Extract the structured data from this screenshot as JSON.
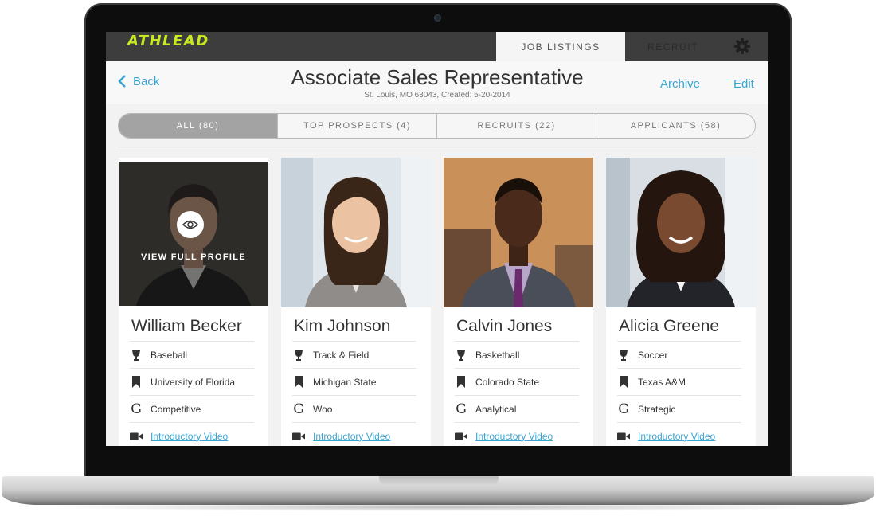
{
  "app": {
    "logo": "ATHLEAD",
    "accent": "#c7ea21",
    "link_color": "#3aa5d3"
  },
  "nav": {
    "tabs": [
      {
        "label": "JOB LISTINGS",
        "active": true
      },
      {
        "label": "RECRUIT",
        "active": false
      }
    ],
    "settings_icon": "gear-icon"
  },
  "header": {
    "back_label": "Back",
    "title": "Associate Sales Representative",
    "subtitle": "St. Louis, MO 63043, Created: 5-20-2014",
    "archive_label": "Archive",
    "edit_label": "Edit"
  },
  "filters": [
    {
      "label": "ALL (80)",
      "selected": true
    },
    {
      "label": "TOP PROSPECTS (4)",
      "selected": false
    },
    {
      "label": "RECRUITS (22)",
      "selected": false
    },
    {
      "label": "APPLICANTS (58)",
      "selected": false
    }
  ],
  "candidates": [
    {
      "name": "William Becker",
      "sport": "Baseball",
      "school": "University of Florida",
      "trait": "Competitive",
      "video_label": "Introductory Video",
      "overlay_label": "VIEW FULL PROFILE"
    },
    {
      "name": "Kim Johnson",
      "sport": "Track & Field",
      "school": "Michigan State",
      "trait": "Woo",
      "video_label": "Introductory Video"
    },
    {
      "name": "Calvin Jones",
      "sport": "Basketball",
      "school": "Colorado State",
      "trait": "Analytical",
      "video_label": "Introductory Video"
    },
    {
      "name": "Alicia Greene",
      "sport": "Soccer",
      "school": "Texas A&M",
      "trait": "Strategic",
      "video_label": "Introductory Video"
    }
  ],
  "icons": {
    "sport": "trophy-icon",
    "school": "bookmark-icon",
    "trait": "g-icon",
    "video": "video-camera-icon",
    "overlay": "eye-icon"
  }
}
